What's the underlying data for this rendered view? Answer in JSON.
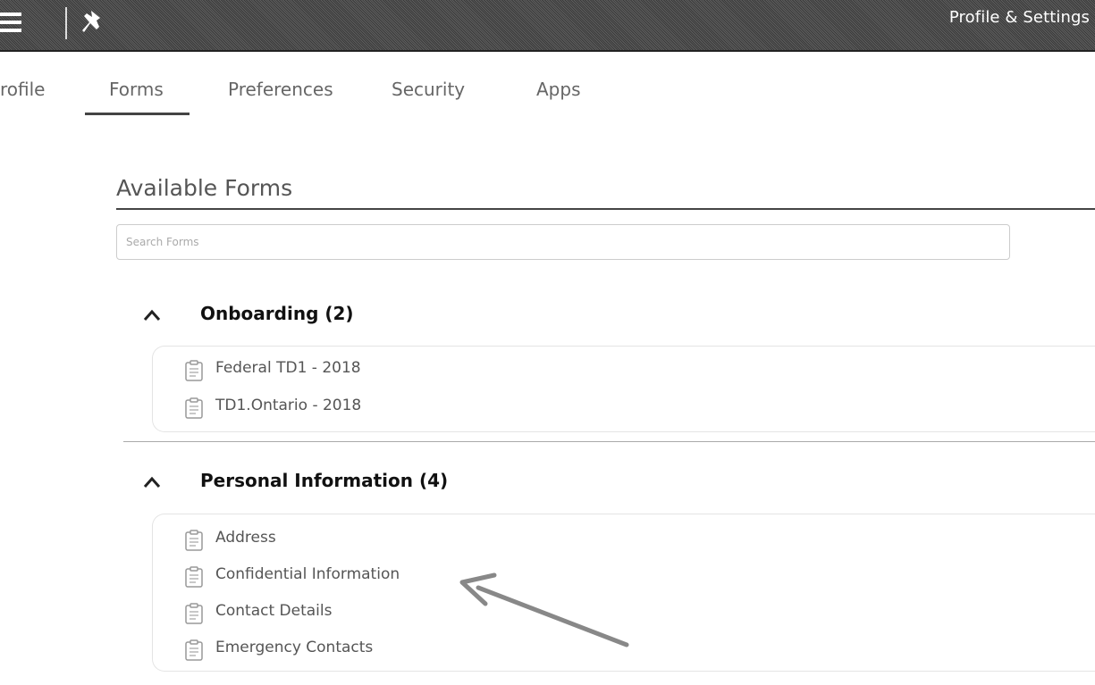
{
  "header": {
    "title": "Profile & Settings",
    "menu_icon": "hamburger-menu-icon",
    "pin_icon": "pin-icon"
  },
  "tabs": [
    {
      "label": "rofile",
      "active": false
    },
    {
      "label": "Forms",
      "active": true
    },
    {
      "label": "Preferences",
      "active": false
    },
    {
      "label": "Security",
      "active": false
    },
    {
      "label": "Apps",
      "active": false
    }
  ],
  "main": {
    "section_title": "Available Forms",
    "search": {
      "placeholder": "Search Forms",
      "value": ""
    },
    "groups": [
      {
        "title": "Onboarding (2)",
        "expanded": true,
        "items": [
          "Federal TD1 - 2018",
          "TD1.Ontario - 2018"
        ]
      },
      {
        "title": "Personal Information (4)",
        "expanded": true,
        "items": [
          "Address",
          "Confidential Information",
          "Contact Details",
          "Emergency Contacts"
        ]
      }
    ]
  },
  "colors": {
    "topbar": "#4a4a4a",
    "tab_text": "#666666",
    "active_underline": "#444444"
  }
}
